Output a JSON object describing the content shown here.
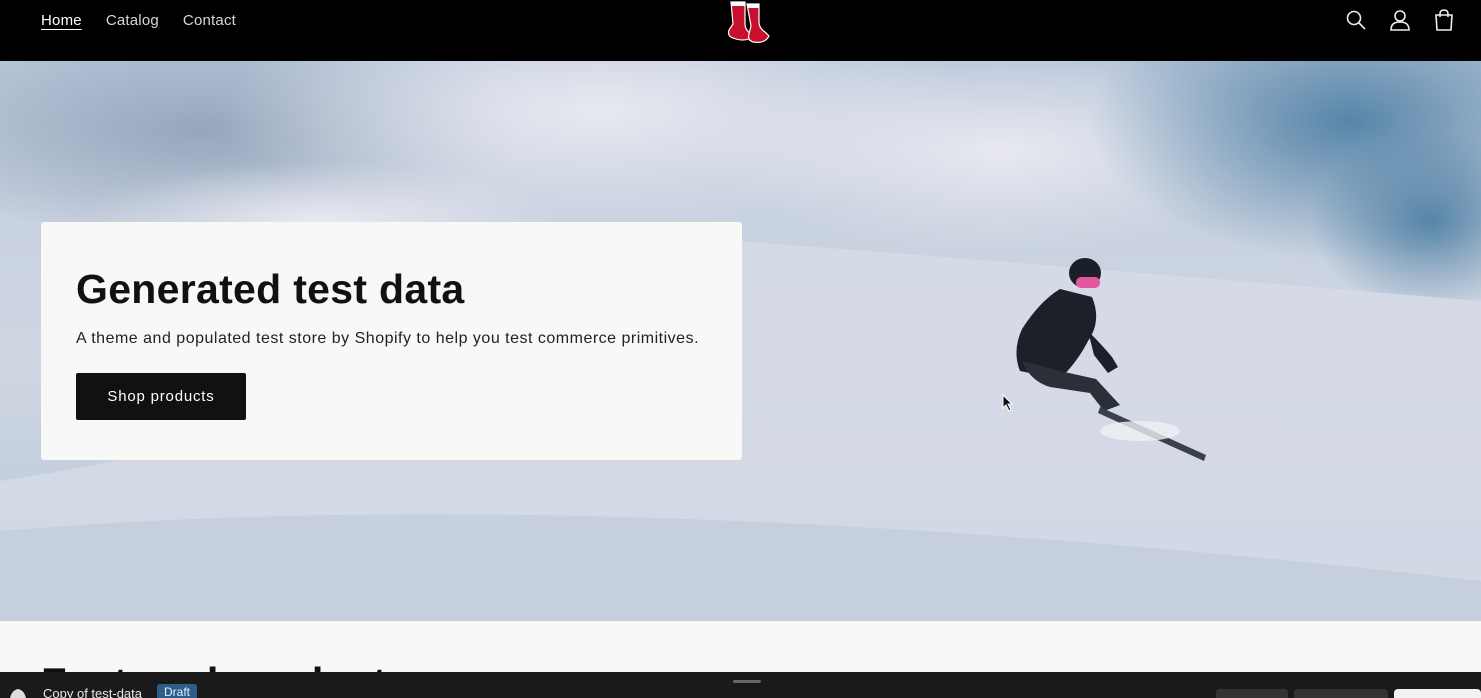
{
  "header": {
    "nav": [
      "Home",
      "Catalog",
      "Contact"
    ],
    "logo_icon": "boston-red-sox-sox-logo",
    "icons": [
      "search-icon",
      "account-icon",
      "cart-icon"
    ]
  },
  "hero": {
    "title": "Generated test data",
    "subtitle": "A theme and populated test store by Shopify to help you test commerce primitives.",
    "button_label": "Shop products",
    "image": "snowboarder-on-snow-slope"
  },
  "section": {
    "heading_partial": "Featured product"
  },
  "bottombar": {
    "theme_name": "Copy of test-data",
    "badge": "Draft"
  },
  "colors": {
    "header_bg": "#000000",
    "button_bg": "#111111",
    "badge_bg": "#2f5d8a"
  }
}
